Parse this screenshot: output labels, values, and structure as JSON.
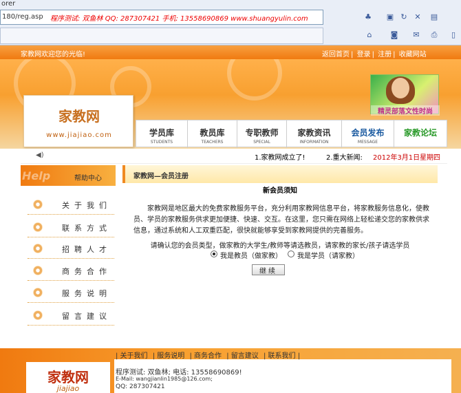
{
  "browser": {
    "title_fragment": "orer",
    "url": "180/reg.asp",
    "ad_text": "程序测试: 双鱼林  QQ: 287307421  手机: 13558690869  www.shuangyulin.com"
  },
  "top": {
    "welcome": "家教网欢迎您的光临!",
    "links": [
      "返回首页",
      "登录",
      "注册",
      "收藏网站"
    ]
  },
  "logo": {
    "cn": "家教网",
    "url": "www.jiajiao.com"
  },
  "ad_banner": {
    "text": "精灵部落文性时尚"
  },
  "nav": [
    {
      "cn": "学员库",
      "en": "STUDENTS"
    },
    {
      "cn": "教员库",
      "en": "TEACHERS"
    },
    {
      "cn": "专职教师",
      "en": "SPECIAL"
    },
    {
      "cn": "家教资讯",
      "en": "INFORMATION"
    },
    {
      "cn": "会员发布",
      "en": "MESSAGE"
    },
    {
      "cn": "家教论坛",
      "en": ""
    }
  ],
  "ticker": {
    "news1": "1.家教网成立了!",
    "news2": "2.重大新闻:",
    "date": "2012年3月1日",
    "weekday": "星期四"
  },
  "sidebar": {
    "head_en": "Help",
    "head_cn": "帮助中心",
    "items": [
      "关于我们",
      "联系方式",
      "招聘人才",
      "商务合作",
      "服务说明",
      "留言建议"
    ]
  },
  "main": {
    "title": "家教网—会员注册",
    "notice_title": "新会员须知",
    "notice_body": "家教网是地区最大的免费家教服务平台，充分利用家教网信息平台，将家教服务信息化，使教员、学员的家教服务供求更加便捷、快速、交互。在这里，您只需在网络上轻松递交您的家教供求信息，通过系统和人工双重匹配，很快就能够享受到家教网提供的完善服务。",
    "prompt": "请确认您的会员类型，做家教的大学生/教师等请选教员，请家教的家长/孩子请选学员",
    "radio1": "我是教员（做家教）",
    "radio2": "我是学员（请家教）",
    "continue": "继续"
  },
  "footer": {
    "logo_cn": "家教网",
    "logo_en": "jiajiao",
    "links": [
      "| 关于我们",
      "| 服务说明",
      "| 商务合作",
      "| 留言建议",
      "| 联系我们 |"
    ],
    "line1": "程序测试: 双鱼林; 电话: 13558690869!",
    "line2": "E-Mail: wangjianlin1985@126.com;",
    "line3": "QQ: 287307421"
  }
}
